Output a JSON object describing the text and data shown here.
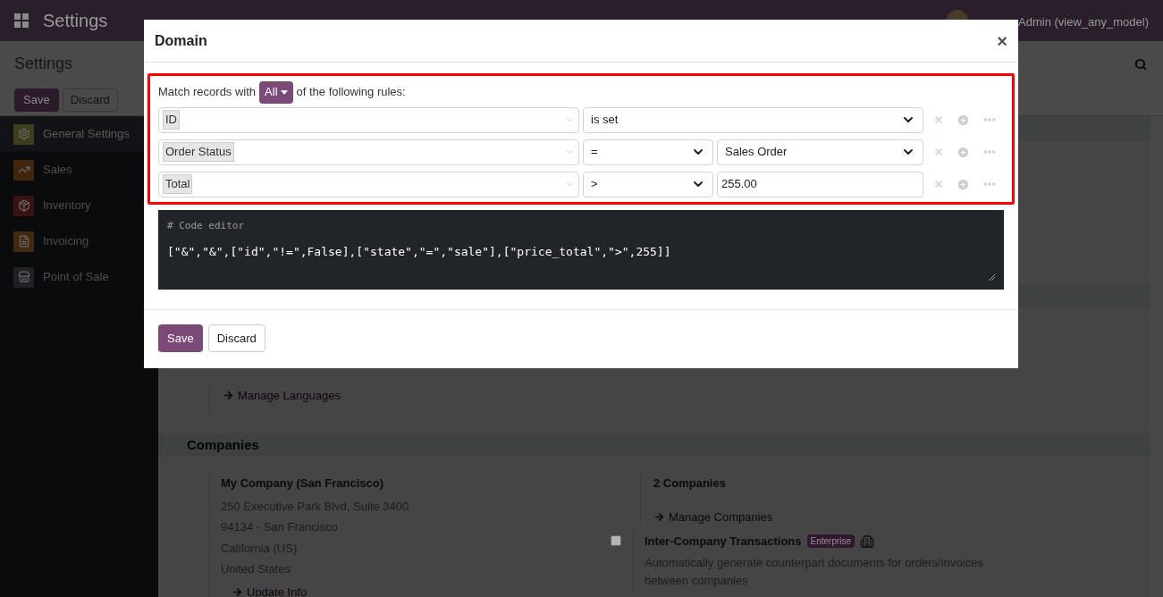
{
  "navbar": {
    "app_title": "Settings",
    "user": "Admin (view_any_model)"
  },
  "control_panel": {
    "title": "Settings",
    "buttons": [
      "Save",
      "Discard"
    ]
  },
  "sidebar": {
    "items": [
      {
        "label": "General Settings",
        "selected": true,
        "color": "#3e3e1c"
      },
      {
        "label": "Sales",
        "selected": false,
        "color": "#40260e"
      },
      {
        "label": "Inventory",
        "selected": false,
        "color": "#3a1214"
      },
      {
        "label": "Invoicing",
        "selected": false,
        "color": "#42280e"
      },
      {
        "label": "Point of Sale",
        "selected": false,
        "color": "#202124"
      }
    ]
  },
  "languages": {
    "links": [
      "Manage Languages"
    ]
  },
  "companies": {
    "title": "Companies",
    "company_name": "My Company (San Francisco)",
    "address": [
      "250 Executive Park Blvd, Suite 3400",
      "94134 - San Francisco",
      "California (US)",
      "United States"
    ],
    "update_link": "Update Info",
    "count": "2 Companies",
    "manage_link": "Manage Companies",
    "inter_company": {
      "title": "Inter-Company Transactions",
      "badge": "Enterprise",
      "checked": false,
      "description": "Automatically generate counterpart documents for orders/invoices between companies"
    }
  },
  "dialog": {
    "title": "Domain",
    "close": "×",
    "match_prefix": "Match records with",
    "match_mode": "All",
    "match_suffix": "of the following rules:",
    "rules": [
      {
        "kind": "unary",
        "field": "ID",
        "operator": "is set"
      },
      {
        "kind": "select",
        "field": "Order Status",
        "operator": "=",
        "value": "Sales Order"
      },
      {
        "kind": "input",
        "field": "Total",
        "operator": ">",
        "value": "255.00"
      }
    ],
    "code_comment": "# Code editor",
    "code": "[\"&\",\"&\",[\"id\",\"!=\",False],[\"state\",\"=\",\"sale\"],[\"price_total\",\">\",255]]",
    "buttons": [
      "Save",
      "Discard"
    ]
  }
}
